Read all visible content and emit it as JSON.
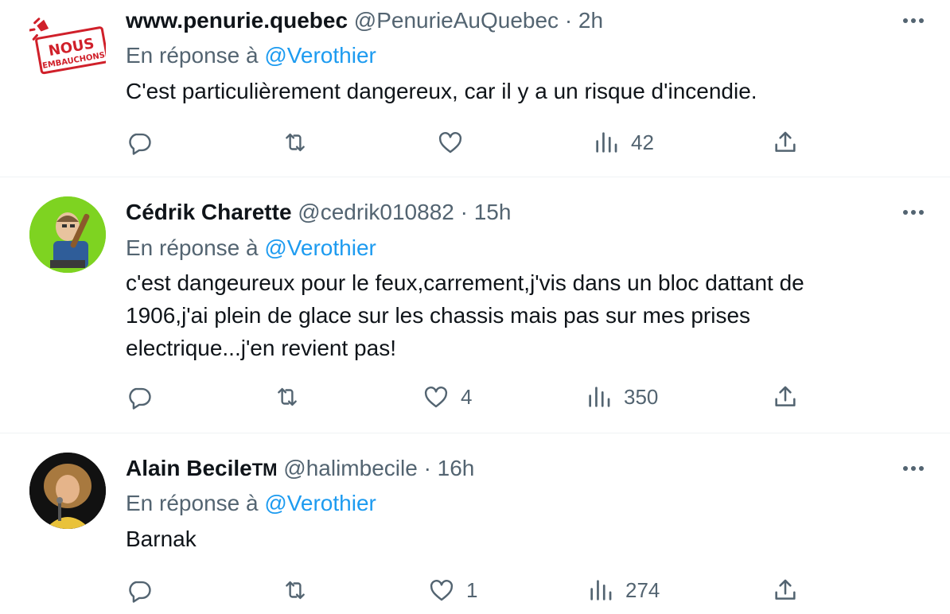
{
  "tweets": [
    {
      "display_name": "www.penurie.quebec",
      "handle": "@PenurieAuQuebec",
      "time": "· 2h",
      "reply_prefix": "En réponse à",
      "reply_to": "@Verothier",
      "lines": [
        "C'est particulièrement dangereux, car il y a un risque d'incendie."
      ],
      "likes": "",
      "views": "42",
      "avatar": {
        "text_top": "NOUS",
        "text_bottom": "EMBAUCHONS",
        "color": "#d0202a"
      }
    },
    {
      "display_name": "Cédrik Charette",
      "handle": "@cedrik010882",
      "time": "· 15h",
      "reply_prefix": "En réponse à",
      "reply_to": "@Verothier",
      "lines": [
        "c'est dangeureux pour le feux,carrement,j'vis dans un bloc dattant de",
        "1906,j'ai plein de glace sur les chassis mais pas sur mes prises",
        "electrique...j'en revient pas!"
      ],
      "likes": "4",
      "views": "350",
      "avatar": {
        "color": "#7ed321"
      }
    },
    {
      "display_name": "Alain Becile",
      "name_suffix": "TM",
      "handle": "@halimbecile",
      "time": "· 16h",
      "reply_prefix": "En réponse à",
      "reply_to": "@Verothier",
      "lines": [
        "Barnak"
      ],
      "likes": "1",
      "views": "274",
      "avatar": {
        "color": "#111111"
      }
    }
  ],
  "colors": {
    "link": "#1d9bf0",
    "meta": "#536471",
    "text": "#0f1419",
    "divider": "#eff3f4"
  },
  "icons": [
    "reply-icon",
    "retweet-icon",
    "like-icon",
    "views-icon",
    "share-icon",
    "more-icon"
  ]
}
